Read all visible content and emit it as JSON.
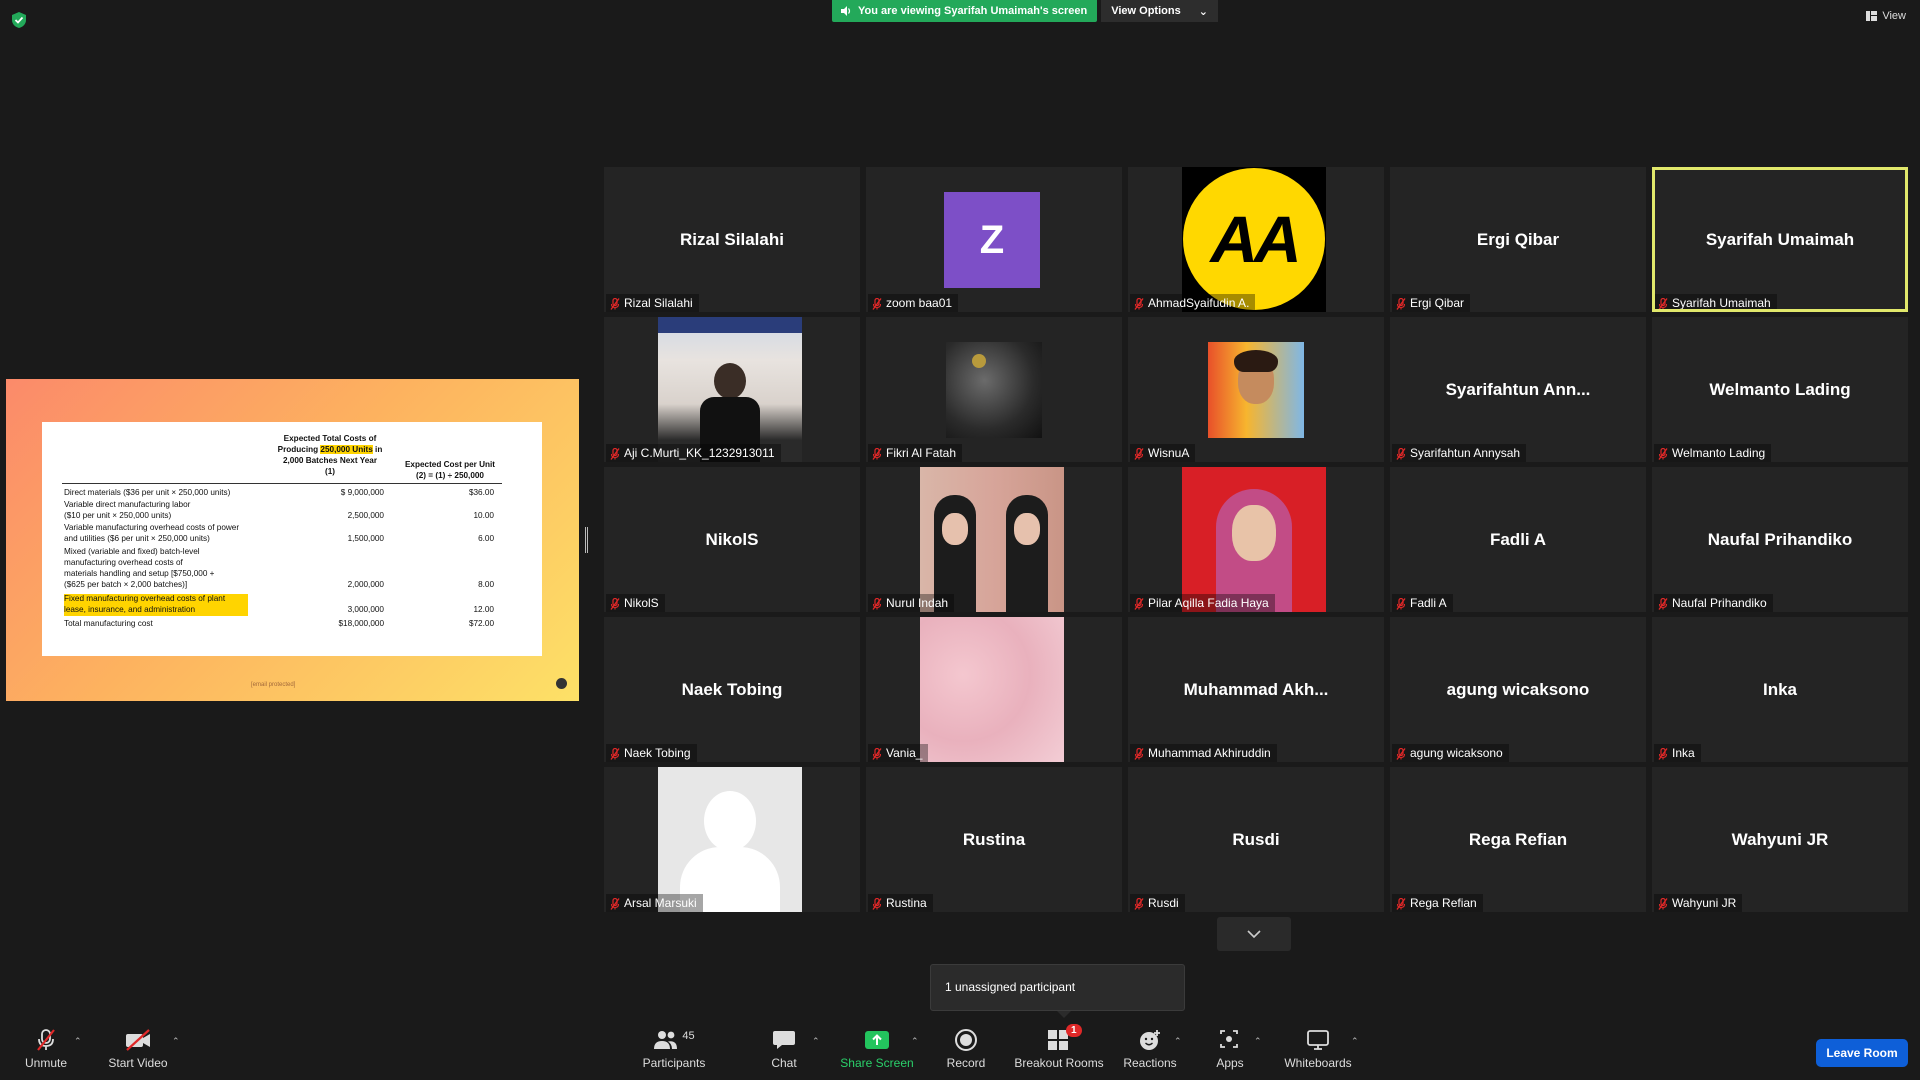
{
  "banner": {
    "viewing": "You are viewing Syarifah Umaimah's screen",
    "view_options": "View Options"
  },
  "view_button": "View",
  "slide": {
    "header_total_l1": "Expected Total Costs of",
    "header_total_l2_pre": "Producing ",
    "header_total_l2_hl": "250,000 Units",
    "header_total_l2_post": " in",
    "header_total_l3": "2,000 Batches Next Year",
    "header_total_l4": "(1)",
    "header_unit_l1": "Expected Cost per Unit",
    "header_unit_l2": "(2) = (1) ÷ 250,000",
    "rows": [
      {
        "d": "Direct materials ($36 per unit × 250,000 units)",
        "v1": "$  9,000,000",
        "v2": "$36.00"
      },
      {
        "d": "Variable direct manufacturing labor",
        "v1": "",
        "v2": ""
      },
      {
        "d": "   ($10 per unit × 250,000 units)",
        "v1": "2,500,000",
        "v2": "10.00"
      },
      {
        "d": "Variable manufacturing overhead costs of power",
        "v1": "",
        "v2": ""
      },
      {
        "d": "   and utilities ($6 per unit × 250,000 units)",
        "v1": "1,500,000",
        "v2": "6.00"
      },
      {
        "d": "Mixed (variable and fixed) batch-level",
        "v1": "",
        "v2": ""
      },
      {
        "d": "   manufacturing overhead costs of",
        "v1": "",
        "v2": ""
      },
      {
        "d": "   materials handling and setup [$750,000 +",
        "v1": "",
        "v2": ""
      },
      {
        "d": "   ($625 per batch × 2,000 batches)]",
        "v1": "2,000,000",
        "v2": "8.00"
      },
      {
        "d": "Fixed manufacturing overhead costs of plant",
        "v1": "",
        "v2": "",
        "hl": true
      },
      {
        "d": "   lease, insurance, and administration",
        "v1": "3,000,000",
        "v2": "12.00",
        "hl": true
      },
      {
        "d": "Total manufacturing cost",
        "v1": "$18,000,000",
        "v2": "$72.00"
      }
    ],
    "footer": "[email protected]"
  },
  "tiles": [
    {
      "big": "Rizal Silalahi",
      "name": "Rizal Silalahi"
    },
    {
      "big": "",
      "name": "zoom baa01",
      "avatar": "Z"
    },
    {
      "big": "",
      "name": "AhmadSyaifudin A.",
      "avatar_aa": "AA"
    },
    {
      "big": "Ergi Qibar",
      "name": "Ergi Qibar"
    },
    {
      "big": "Syarifah Umaimah",
      "name": "Syarifah Umaimah",
      "active": true
    },
    {
      "big": "",
      "name": "Aji C.Murti_KK_1232913011",
      "photo": "aji"
    },
    {
      "big": "",
      "name": "Fikri Al Fatah",
      "photo": "fikri"
    },
    {
      "big": "",
      "name": "WisnuA",
      "photo": "wisnu"
    },
    {
      "big": "Syarifahtun  Ann...",
      "name": "Syarifahtun Annysah"
    },
    {
      "big": "Welmanto Lading",
      "name": "Welmanto Lading"
    },
    {
      "big": "NikolS",
      "name": "NikolS"
    },
    {
      "big": "",
      "name": "Nurul Indah",
      "photo": "nurul"
    },
    {
      "big": "",
      "name": "Pilar Aqilla Fadia Haya",
      "photo": "pilar"
    },
    {
      "big": "Fadli A",
      "name": "Fadli A"
    },
    {
      "big": "Naufal Prihandiko",
      "name": "Naufal Prihandiko"
    },
    {
      "big": "Naek Tobing",
      "name": "Naek Tobing"
    },
    {
      "big": "",
      "name": "Vania_",
      "photo": "vania"
    },
    {
      "big": "Muhammad  Akh...",
      "name": "Muhammad Akhiruddin"
    },
    {
      "big": "agung wicaksono",
      "name": "agung wicaksono"
    },
    {
      "big": "Inka",
      "name": "Inka"
    },
    {
      "big": "",
      "name": "Arsal Marsuki",
      "photo": "arsal"
    },
    {
      "big": "Rustina",
      "name": "Rustina"
    },
    {
      "big": "Rusdi",
      "name": "Rusdi"
    },
    {
      "big": "Rega Refian",
      "name": "Rega Refian"
    },
    {
      "big": "Wahyuni JR",
      "name": "Wahyuni JR"
    }
  ],
  "tooltip": "1 unassigned participant",
  "toolbar": {
    "unmute": "Unmute",
    "start_video": "Start Video",
    "participants": "Participants",
    "participants_count": "45",
    "chat": "Chat",
    "share_screen": "Share Screen",
    "record": "Record",
    "breakout_rooms": "Breakout Rooms",
    "breakout_badge": "1",
    "reactions": "Reactions",
    "apps": "Apps",
    "whiteboards": "Whiteboards",
    "leave_room": "Leave Room"
  },
  "colors": {
    "active_border": "#e1e86b",
    "share_green": "#23a95a",
    "leave_blue": "#0e5fd8",
    "mute_red": "#e02828"
  }
}
